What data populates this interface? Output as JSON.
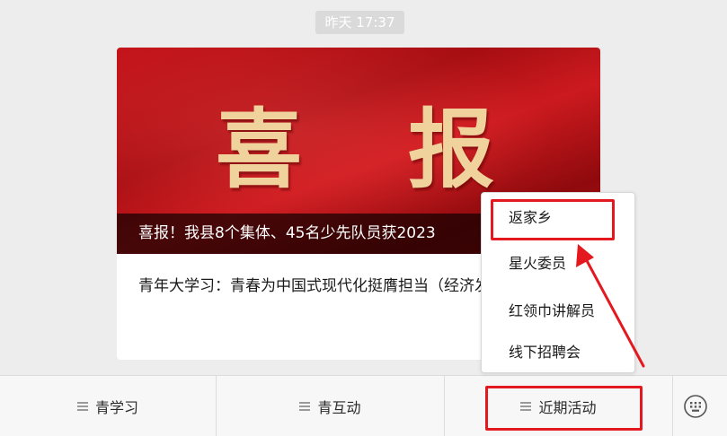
{
  "chat": {
    "timestamp": "昨天 17:37"
  },
  "article": {
    "banner_text": "喜报",
    "banner_title": "喜报！我县8个集体、45名少先队员获2023",
    "subtitle": "青年大学习：青春为中国式现代化挺膺担当（经济发展篇）"
  },
  "popup_menu": {
    "items": [
      {
        "label": "返家乡"
      },
      {
        "label": "星火委员"
      },
      {
        "label": "红领巾讲解员"
      },
      {
        "label": "线下招聘会"
      }
    ]
  },
  "menubar": {
    "buttons": [
      {
        "label": "青学习"
      },
      {
        "label": "青互动"
      },
      {
        "label": "近期活动"
      }
    ],
    "keyboard_icon": "keyboard-icon",
    "menu_icon": "hamburger-icon"
  },
  "annotation": {
    "color": "#e3191f"
  }
}
